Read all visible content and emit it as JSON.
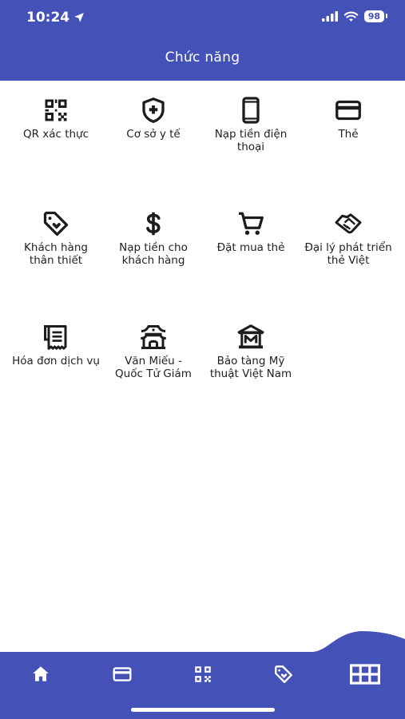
{
  "status": {
    "time": "10:24",
    "battery": "98"
  },
  "header": {
    "title": "Chức năng"
  },
  "functions": [
    {
      "label": "QR xác thực",
      "icon": "qr-code-icon"
    },
    {
      "label": "Cơ sở y tế",
      "icon": "shield-plus-icon"
    },
    {
      "label": "Nạp tiền điện thoại",
      "icon": "phone-icon"
    },
    {
      "label": "Thẻ",
      "icon": "card-icon"
    },
    {
      "label": "Khách hàng thân thiết",
      "icon": "heart-tag-icon"
    },
    {
      "label": "Nạp tiền cho khách hàng",
      "icon": "dollar-icon"
    },
    {
      "label": "Đặt mua thẻ",
      "icon": "cart-icon"
    },
    {
      "label": "Đại lý phát triển thẻ Việt",
      "icon": "handshake-icon"
    },
    {
      "label": "Hóa đơn dịch vụ",
      "icon": "receipt-icon"
    },
    {
      "label": "Văn Miếu - Quốc Tử Giám",
      "icon": "temple-icon"
    },
    {
      "label": "Bảo tàng Mỹ thuật Việt Nam",
      "icon": "museum-icon"
    }
  ],
  "nav": [
    {
      "icon": "home-icon"
    },
    {
      "icon": "card-icon"
    },
    {
      "icon": "qr-code-icon"
    },
    {
      "icon": "tag-icon"
    },
    {
      "icon": "grid-icon",
      "active": true
    }
  ],
  "colors": {
    "primary": "#4452b8",
    "icon": "#1c1c1c",
    "background": "#ffffff"
  }
}
